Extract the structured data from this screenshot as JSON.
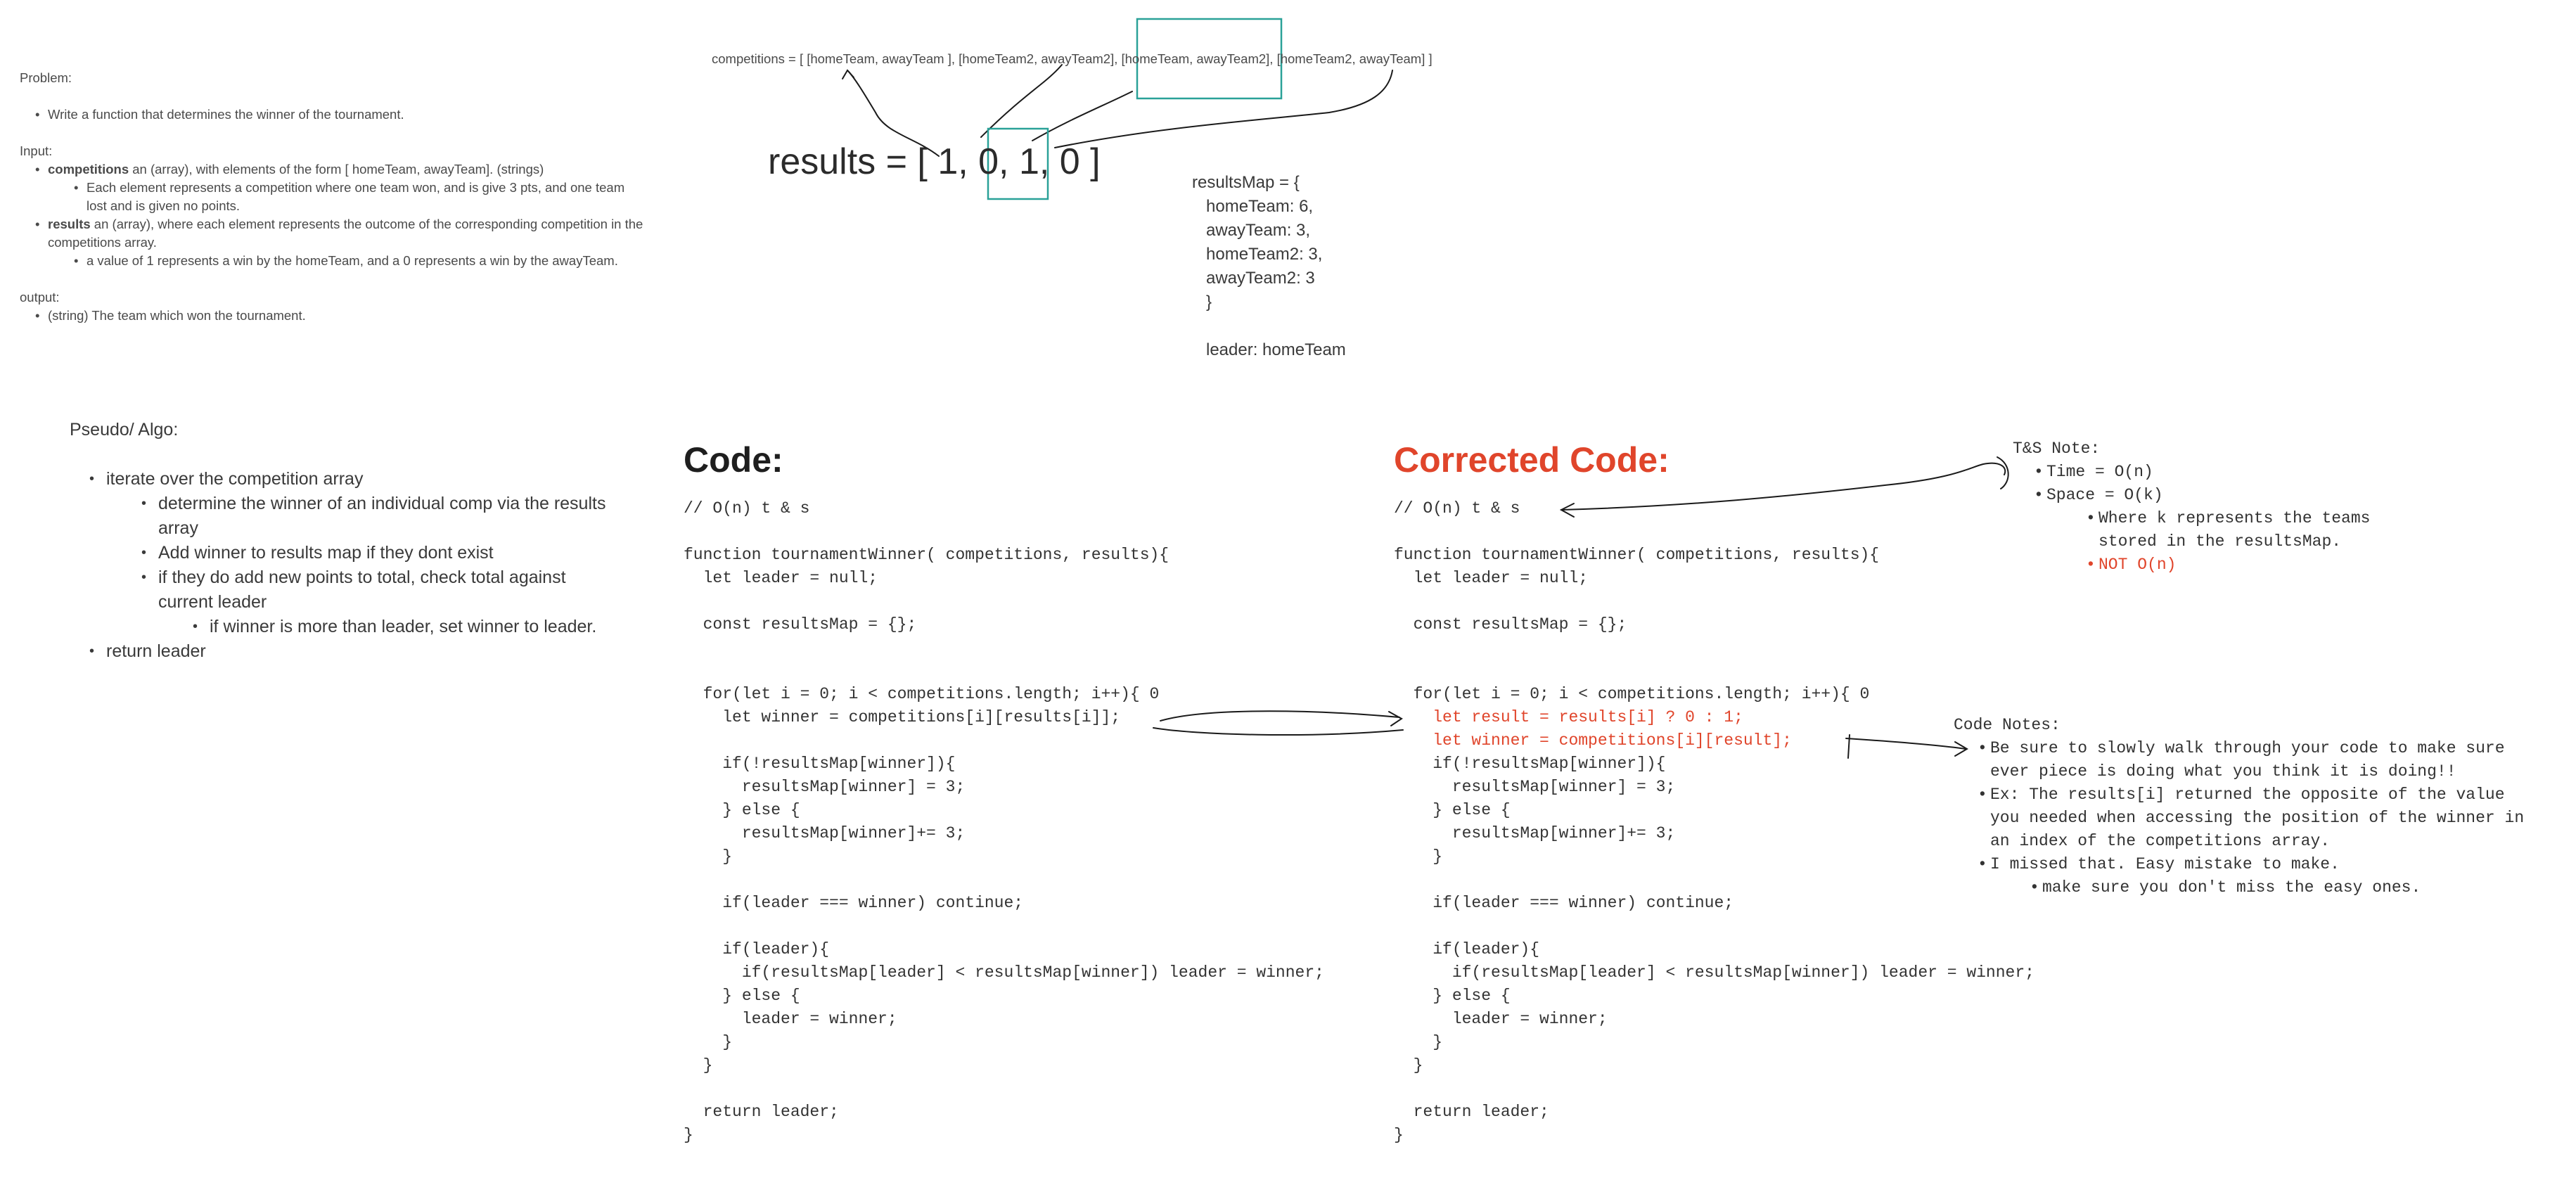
{
  "problem": {
    "heading": "Problem:",
    "items": [
      "Write a function that determines the winner of the tournament."
    ],
    "input_heading": "Input:",
    "competitions_bold": "competitions",
    "competitions_text": " an (array), with elements of the form [ homeTeam, awayTeam]. (strings)",
    "competitions_sub": "Each element represents a competition where one team won, and is give 3 pts, and one team lost and is given no points.",
    "results_bold": "results",
    "results_text": " an (array), where each element represents the outcome of the corresponding competition in the competitions array.",
    "results_sub": "a value of 1 represents a win by the homeTeam, and a 0 represents a win by the awayTeam.",
    "output_heading": "output:",
    "output_item": "(string) The team which won the tournament."
  },
  "competitions_line": "competitions = [ [homeTeam, awayTeam ], [homeTeam2, awayTeam2], [homeTeam, awayTeam2], [homeTeam2, awayTeam] ]",
  "results_array": "results = [ 1, 0, 1, 0 ]",
  "results_map": "resultsMap = {\n   homeTeam: 6,\n   awayTeam: 3,\n   homeTeam2: 3,\n   awayTeam2: 3\n   }\n\n   leader: homeTeam",
  "pseudo": {
    "heading": "Pseudo/ Algo:",
    "step1": "iterate over the competition array",
    "step1a": "determine the winner of an individual comp via the results array",
    "step1b": "Add winner to results map if they dont exist",
    "step1c": "if they do add new points to total, check total against current leader",
    "step1c1": "if winner is more than leader, set winner to leader.",
    "step2": "return leader"
  },
  "code": {
    "title": "Code:",
    "body": "// O(n) t & s\n\nfunction tournamentWinner( competitions, results){\n  let leader = null;\n\n  const resultsMap = {};\n\n\n  for(let i = 0; i < competitions.length; i++){ 0\n    let winner = competitions[i][results[i]];\n\n    if(!resultsMap[winner]){\n      resultsMap[winner] = 3;\n    } else {\n      resultsMap[winner]+= 3;\n    }\n\n    if(leader === winner) continue;\n\n    if(leader){\n      if(resultsMap[leader] < resultsMap[winner]) leader = winner;\n    } else {\n      leader = winner;\n    }\n  }\n\n  return leader;\n}"
  },
  "corrected": {
    "title": "Corrected Code:",
    "head": "// O(n) t & s\n\nfunction tournamentWinner( competitions, results){\n  let leader = null;\n\n  const resultsMap = {};\n\n\n  for(let i = 0; i < competitions.length; i++){ 0",
    "red1": "    let result = results[i] ? 0 : 1;",
    "red2": "    let winner = competitions[i][result];",
    "tail": "\n    if(!resultsMap[winner]){\n      resultsMap[winner] = 3;\n    } else {\n      resultsMap[winner]+= 3;\n    }\n\n    if(leader === winner) continue;\n\n    if(leader){\n      if(resultsMap[leader] < resultsMap[winner]) leader = winner;\n    } else {\n      leader = winner;\n    }\n  }\n\n  return leader;\n}"
  },
  "ts_note": {
    "heading": "T&S Note:",
    "time": "Time = O(n)",
    "space": "Space = O(k)",
    "where": "Where k represents the teams\nstored in the resultsMap.",
    "not": "NOT O(n)"
  },
  "code_notes": {
    "heading": "Code Notes:",
    "n1": "Be sure to slowly walk through your code to make sure\never piece is doing what you think it is doing!!",
    "n2": "Ex: The results[i] returned the opposite of the value\nyou needed when accessing the position of the winner in\nan index of the competitions array.",
    "n3": "I missed that. Easy mistake to make.",
    "n3a": "make sure you don't miss the easy ones."
  },
  "colors": {
    "accent_red": "#e0452b",
    "highlight_teal": "#2aa198"
  }
}
